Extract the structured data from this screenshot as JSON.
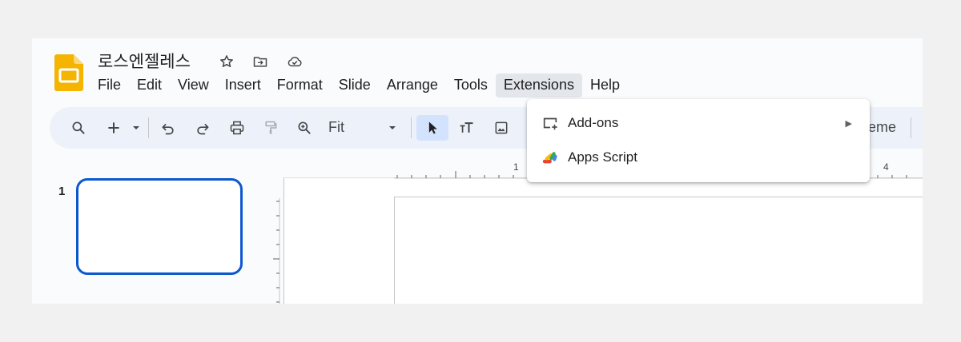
{
  "document": {
    "title": "로스엔젤레스"
  },
  "title_icons": [
    "star-icon",
    "move-to-folder-icon",
    "cloud-saved-icon"
  ],
  "menubar": {
    "items": [
      {
        "label": "File"
      },
      {
        "label": "Edit"
      },
      {
        "label": "View"
      },
      {
        "label": "Insert"
      },
      {
        "label": "Format"
      },
      {
        "label": "Slide"
      },
      {
        "label": "Arrange"
      },
      {
        "label": "Tools"
      },
      {
        "label": "Extensions",
        "active": true
      },
      {
        "label": "Help"
      }
    ]
  },
  "toolbar": {
    "zoom_value": "Fit",
    "theme_partial": "eme",
    "icons": [
      "search-icon",
      "new-slide-icon",
      "new-slide-dropdown-icon",
      "undo-icon",
      "redo-icon",
      "print-icon",
      "paint-format-icon",
      "zoom-icon",
      "select-icon",
      "text-box-icon",
      "image-icon"
    ]
  },
  "filmstrip": {
    "slide_number": "1"
  },
  "ruler": {
    "labels": [
      "1",
      "4"
    ]
  },
  "extensions_menu": {
    "items": [
      {
        "label": "Add-ons",
        "icon": "add-ons-icon",
        "has_submenu": true
      },
      {
        "label": "Apps Script",
        "icon": "apps-script-icon",
        "has_submenu": false
      }
    ]
  },
  "colors": {
    "accent": "#0b57d0",
    "toolbar_bg": "#edf2fa",
    "selected_tool_bg": "#d3e3fd",
    "logo": "#f4b400"
  }
}
